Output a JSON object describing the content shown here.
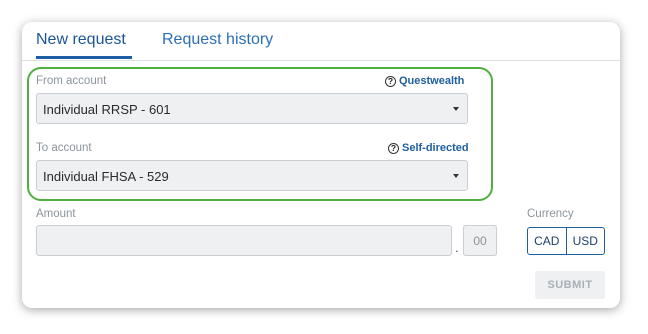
{
  "tabs": [
    {
      "label": "New request",
      "active": true
    },
    {
      "label": "Request history",
      "active": false
    }
  ],
  "from_account": {
    "label": "From account",
    "help_text": "Questwealth",
    "value": "Individual RRSP - 601"
  },
  "to_account": {
    "label": "To account",
    "help_text": "Self-directed",
    "value": "Individual FHSA - 529"
  },
  "amount": {
    "label": "Amount",
    "value": "",
    "decimal_separator": ".",
    "cents": "00"
  },
  "currency": {
    "label": "Currency",
    "options": [
      "CAD",
      "USD"
    ]
  },
  "submit_label": "SUBMIT",
  "colors": {
    "accent": "#1f5fa0",
    "highlight": "#4fb040",
    "disabled_text": "#a9b0b8"
  }
}
